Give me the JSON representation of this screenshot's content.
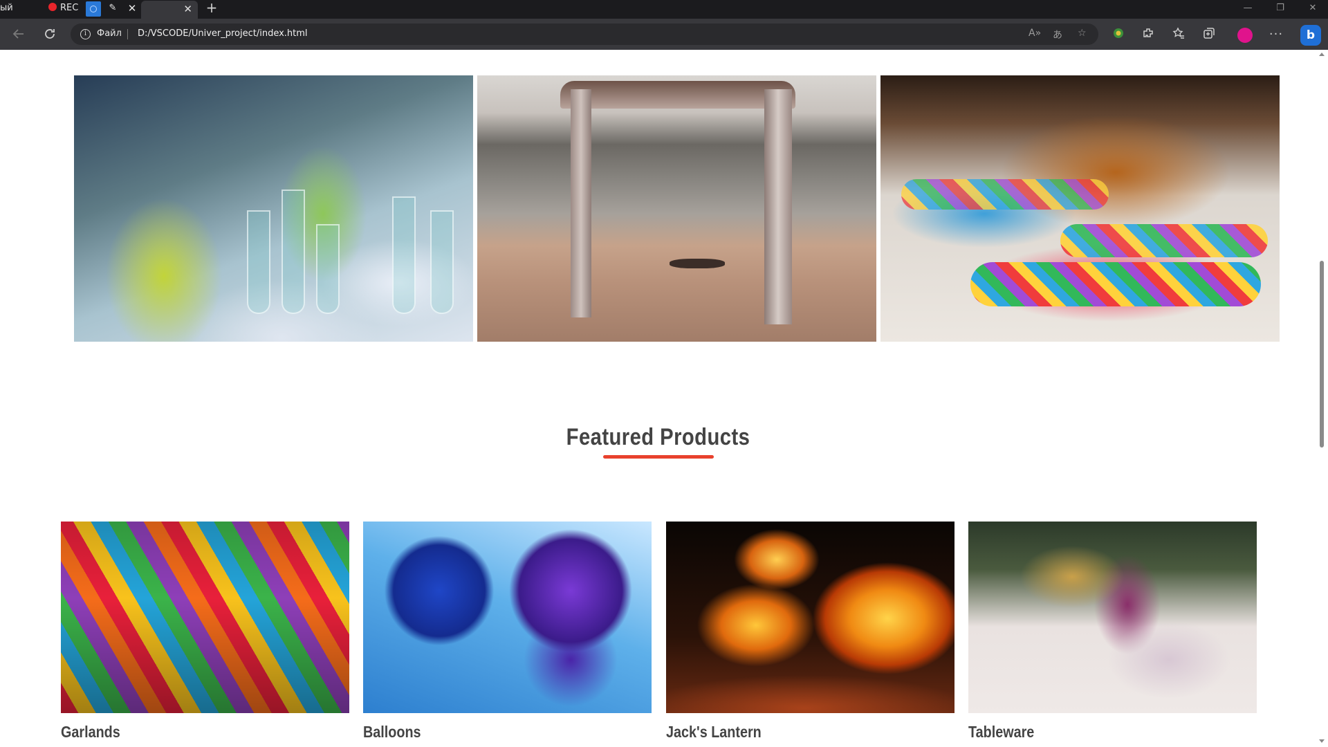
{
  "browser": {
    "tabs": {
      "screen_label": "ый экран",
      "rec_label": "REC",
      "close_glyph": "✕",
      "pen_glyph": "✎",
      "new_tab_glyph": "+"
    },
    "window_controls": [
      "—",
      "❐",
      "✕"
    ],
    "address_bar": {
      "scheme_label": "Файл",
      "url": "D:/VSCODE/Univer_project/index.html"
    },
    "toolbar_icons": [
      "back-icon",
      "refresh-icon",
      "read-aloud-icon",
      "translate-icon",
      "favorite-add-icon",
      "extension-icon",
      "extensions-icon",
      "favorites-icon",
      "collections-icon",
      "profile-icon",
      "more-icon",
      "bing-icon"
    ],
    "profile_color": "#e0138c",
    "more_glyph": "···",
    "bing_glyph": "b"
  },
  "page": {
    "gallery": [
      {
        "name": "table-setting-photo"
      },
      {
        "name": "beach-wedding-arch-photo"
      },
      {
        "name": "party-streamers-photo"
      }
    ],
    "featured": {
      "title": "Featured Products",
      "accent_color": "#e8412d",
      "products": [
        {
          "name": "Garlands"
        },
        {
          "name": "Balloons"
        },
        {
          "name": "Jack's Lantern"
        },
        {
          "name": "Tableware"
        }
      ]
    }
  }
}
